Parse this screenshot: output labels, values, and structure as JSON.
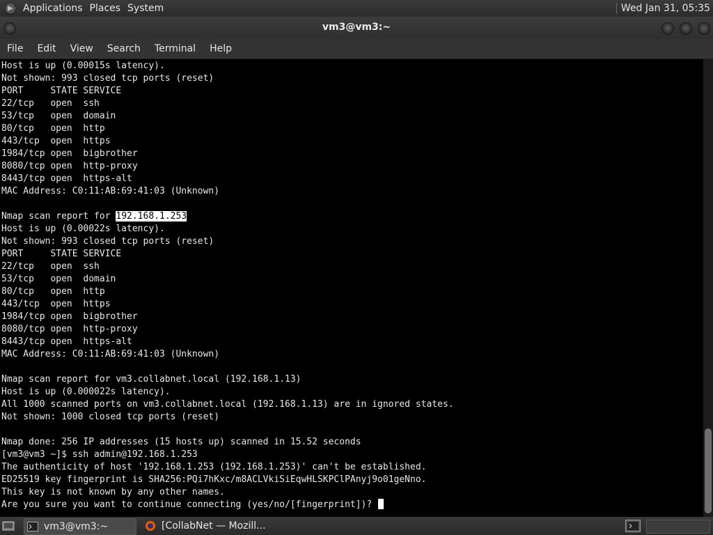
{
  "top_panel": {
    "menus": [
      "Applications",
      "Places",
      "System"
    ],
    "clock": "Wed Jan 31, 05:35"
  },
  "window": {
    "title": "vm3@vm3:~",
    "menu": [
      "File",
      "Edit",
      "View",
      "Search",
      "Terminal",
      "Help"
    ]
  },
  "terminal": {
    "lines": [
      "Host is up (0.00015s latency).",
      "Not shown: 993 closed tcp ports (reset)",
      "PORT     STATE SERVICE",
      "22/tcp   open  ssh",
      "53/tcp   open  domain",
      "80/tcp   open  http",
      "443/tcp  open  https",
      "1984/tcp open  bigbrother",
      "8080/tcp open  http-proxy",
      "8443/tcp open  https-alt",
      "MAC Address: C0:11:AB:69:41:03 (Unknown)",
      "",
      "Nmap scan report for ",
      "Host is up (0.00022s latency).",
      "Not shown: 993 closed tcp ports (reset)",
      "PORT     STATE SERVICE",
      "22/tcp   open  ssh",
      "53/tcp   open  domain",
      "80/tcp   open  http",
      "443/tcp  open  https",
      "1984/tcp open  bigbrother",
      "8080/tcp open  http-proxy",
      "8443/tcp open  https-alt",
      "MAC Address: C0:11:AB:69:41:03 (Unknown)",
      "",
      "Nmap scan report for vm3.collabnet.local (192.168.1.13)",
      "Host is up (0.000022s latency).",
      "All 1000 scanned ports on vm3.collabnet.local (192.168.1.13) are in ignored states.",
      "Not shown: 1000 closed tcp ports (reset)",
      "",
      "Nmap done: 256 IP addresses (15 hosts up) scanned in 15.52 seconds",
      "[vm3@vm3 ~]$ ssh admin@192.168.1.253",
      "The authenticity of host '192.168.1.253 (192.168.1.253)' can't be established.",
      "ED25519 key fingerprint is SHA256:PQi7hKxc/m8ACLVkiSiEqwHLSKPClPAnyj9o01geNno.",
      "This key is not known by any other names.",
      "Are you sure you want to continue connecting (yes/no/[fingerprint])? "
    ],
    "selected_text": "192.168.1.253"
  },
  "taskbar": {
    "tasks": [
      "vm3@vm3:~",
      "[CollabNet — Mozill..."
    ]
  },
  "colors": {
    "terminal_bg": "#000000",
    "terminal_fg": "#e8e8e8",
    "panel_bg": "#2c2c2c"
  }
}
